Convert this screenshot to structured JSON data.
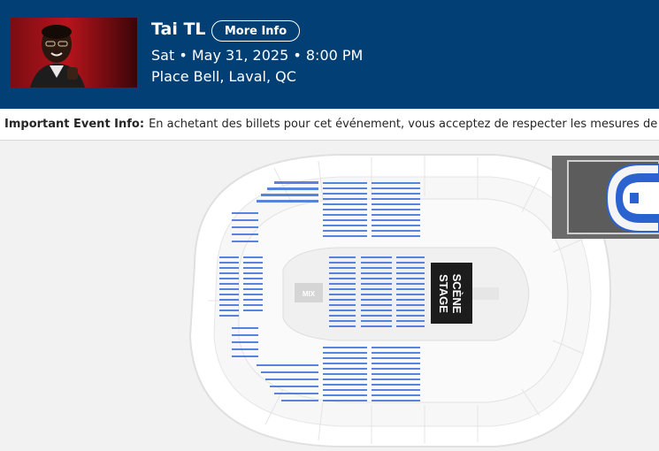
{
  "header": {
    "title": "Tai TL",
    "more_info_label": "More Info",
    "date_time": "Sat • May 31, 2025 • 8:00 PM",
    "venue": "Place Bell, Laval, QC"
  },
  "info_bar": {
    "label": "Important Event Info:",
    "text": "En achetant des billets pour cet événement, vous acceptez de respecter les mesures de sécurité"
  },
  "seat_map": {
    "mix_label": "MIX",
    "stage_label_fr": "SCÈNE",
    "stage_label_en": "STAGE"
  },
  "colors": {
    "header_bg": "#023f74",
    "seat_available": "#3a6fd8",
    "stage_bg": "#1c1c1c"
  }
}
